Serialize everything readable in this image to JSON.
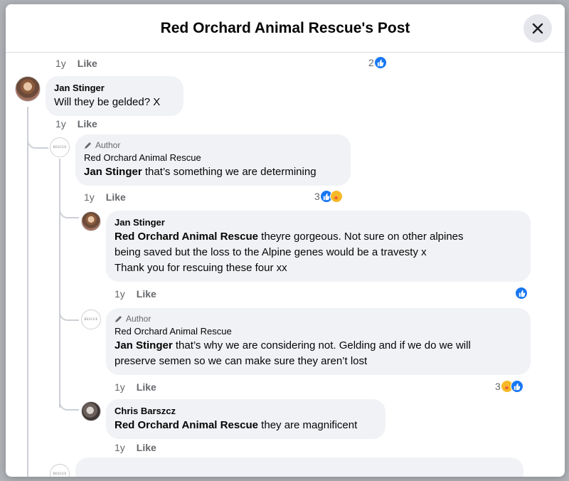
{
  "modal": {
    "title": "Red Orchard Animal Rescue's Post",
    "close_icon": "close-icon"
  },
  "colors": {
    "like_blue": "#1877f2",
    "care_yellow": "#f7b928",
    "bubble": "#f0f2f5",
    "meta": "#65676b"
  },
  "top_meta": {
    "time": "1y",
    "like": "Like",
    "reaction_count": "2"
  },
  "comments": [
    {
      "author": "Jan Stinger",
      "text": "Will they be gelded? X",
      "time": "1y",
      "like": "Like"
    },
    {
      "author_tag": "Author",
      "author": "Red Orchard Animal Rescue",
      "mention": "Jan Stinger",
      "text": " that’s something we are determining",
      "time": "1y",
      "like": "Like",
      "reaction_count": "3"
    },
    {
      "author": "Jan Stinger",
      "mention": "Red Orchard Animal Rescue",
      "text_line1": " theyre gorgeous. Not sure on other alpines",
      "text_line2": "being saved but the loss to the Alpine genes would be a travesty x",
      "text_line3": "Thank you for rescuing these four xx",
      "time": "1y",
      "like": "Like"
    },
    {
      "author_tag": "Author",
      "author": "Red Orchard Animal Rescue",
      "mention": "Jan Stinger",
      "text_line1": " that’s why we are considering not. Gelding and if we do we will",
      "text_line2": "preserve semen so we can make sure they aren’t lost",
      "time": "1y",
      "like": "Like",
      "reaction_count": "3"
    },
    {
      "author": "Chris Barszcz",
      "mention": "Red Orchard Animal Rescue",
      "text": " they are magnificent",
      "time": "1y",
      "like": "Like"
    }
  ]
}
